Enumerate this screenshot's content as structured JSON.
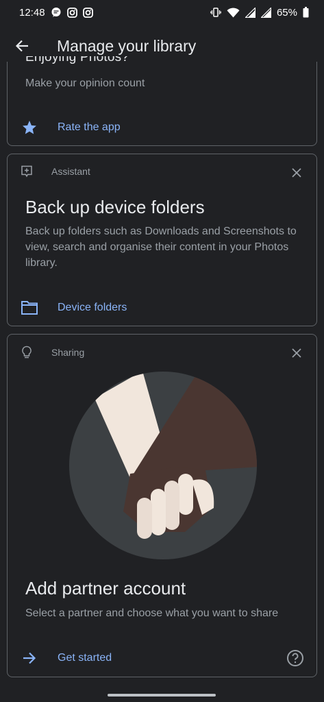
{
  "status_bar": {
    "time": "12:48",
    "battery": "65%",
    "left_icons": [
      "message-icon",
      "instagram-icon",
      "instagram-icon"
    ],
    "right_icons": [
      "vibrate-icon",
      "wifi-icon",
      "signal-icon",
      "signal-icon",
      "battery-icon"
    ]
  },
  "app_bar": {
    "title": "Manage your library",
    "back_icon": "arrow-back-icon"
  },
  "cards": {
    "rate": {
      "title_partial": "Enjoying Photos?",
      "subtitle": "Make your opinion count",
      "action_label": "Rate the app",
      "action_icon": "star-icon"
    },
    "backup": {
      "category": "Assistant",
      "category_icon": "assistant-icon",
      "title": "Back up device folders",
      "subtitle": "Back up folders such as Downloads and Screenshots to view, search and organise their content in your Photos library.",
      "action_label": "Device folders",
      "action_icon": "folder-icon"
    },
    "partner": {
      "category": "Sharing",
      "category_icon": "lightbulb-icon",
      "title": "Add partner account",
      "subtitle": "Select a partner and choose what you want to share",
      "action_label": "Get started",
      "action_icon": "arrow-forward-icon",
      "help_icon": "help-icon"
    }
  },
  "colors": {
    "background": "#202124",
    "card_border": "#5f6368",
    "accent": "#8ab4f8",
    "primary_text": "#e8eaed",
    "secondary_text": "#9aa0a6"
  }
}
